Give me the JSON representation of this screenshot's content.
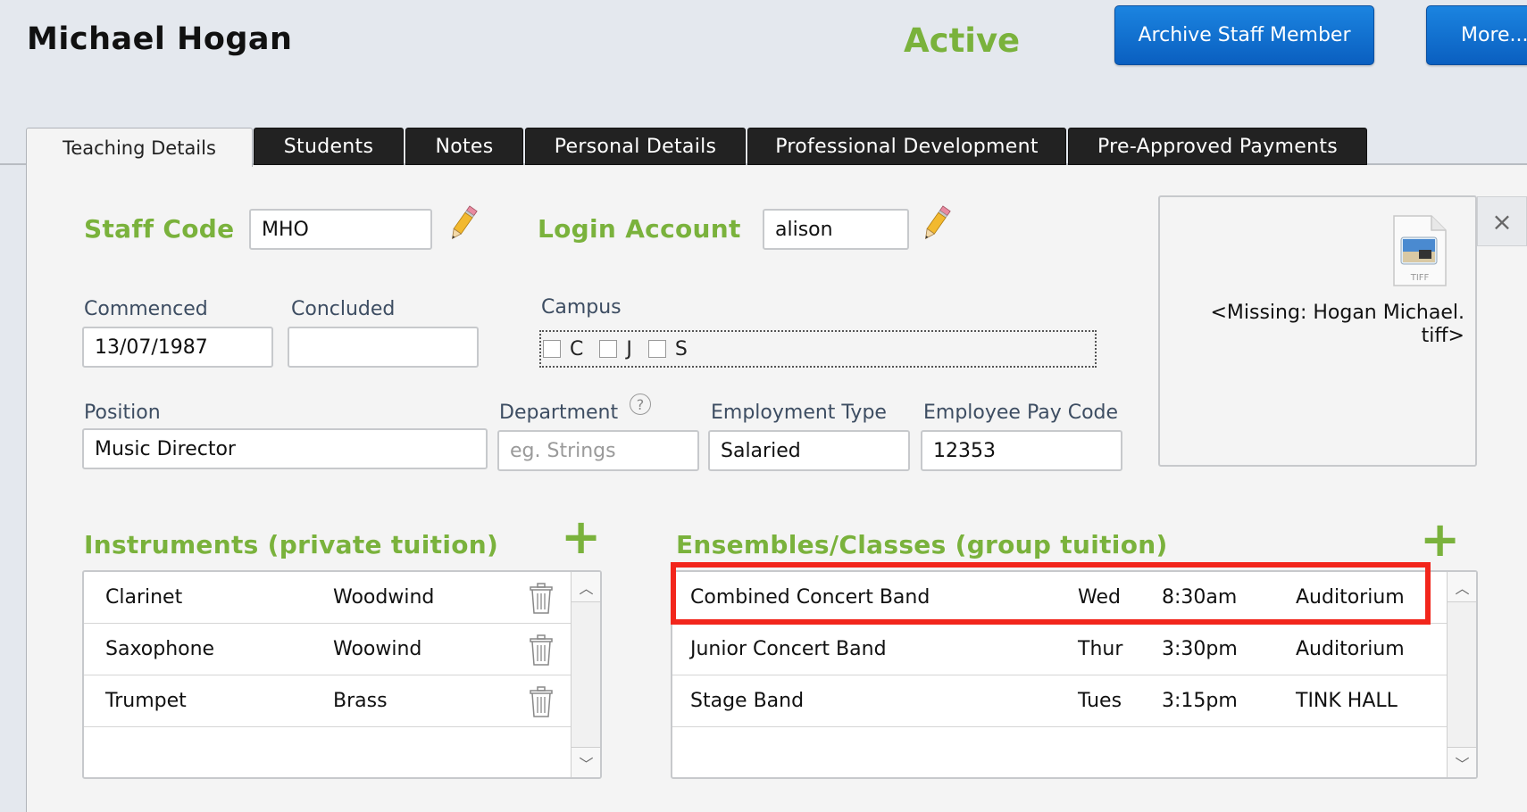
{
  "header": {
    "staff_name": "Michael Hogan",
    "status": "Active",
    "archive_button": "Archive Staff Member",
    "more_button": "More..."
  },
  "tabs": [
    {
      "label": "Teaching Details",
      "active": true
    },
    {
      "label": "Students"
    },
    {
      "label": "Notes"
    },
    {
      "label": "Personal Details"
    },
    {
      "label": "Professional Development"
    },
    {
      "label": "Pre-Approved Payments"
    }
  ],
  "form": {
    "staff_code_label": "Staff Code",
    "staff_code_value": "MHO",
    "login_account_label": "Login Account",
    "login_account_value": "alison",
    "commenced_label": "Commenced",
    "commenced_value": "13/07/1987",
    "concluded_label": "Concluded",
    "concluded_value": "",
    "campus_label": "Campus",
    "campus_options": [
      {
        "label": "C",
        "checked": false
      },
      {
        "label": "J",
        "checked": false
      },
      {
        "label": "S",
        "checked": false
      }
    ],
    "position_label": "Position",
    "position_value": "Music Director",
    "department_label": "Department",
    "department_placeholder": "eg. Strings",
    "help_glyph": "?",
    "employment_type_label": "Employment Type",
    "employment_type_value": "Salaried",
    "pay_code_label": "Employee Pay Code",
    "pay_code_value": "12353"
  },
  "photo": {
    "file_type": "TIFF",
    "missing_line1": "<Missing: Hogan Michael.",
    "missing_line2": "tiff>",
    "close_glyph": "×"
  },
  "instruments": {
    "title": "Instruments (private tuition)",
    "add_glyph": "+",
    "rows": [
      {
        "name": "Clarinet",
        "family": "Woodwind"
      },
      {
        "name": "Saxophone",
        "family": "Woowind"
      },
      {
        "name": "Trumpet",
        "family": "Brass"
      }
    ]
  },
  "ensembles": {
    "title": "Ensembles/Classes (group tuition)",
    "add_glyph": "+",
    "rows": [
      {
        "name": "Combined Concert Band",
        "day": "Wed",
        "time": "8:30am",
        "venue": "Auditorium"
      },
      {
        "name": "Junior Concert Band",
        "day": "Thur",
        "time": "3:30pm",
        "venue": "Auditorium"
      },
      {
        "name": "Stage Band",
        "day": "Tues",
        "time": "3:15pm",
        "venue": "TINK HALL"
      }
    ]
  },
  "scroll_glyphs": {
    "up": "︿",
    "down": "﹀"
  },
  "colors": {
    "accent_green": "#7ab23c",
    "button_blue": "#0a6fd1",
    "highlight_red": "#f2261c"
  }
}
